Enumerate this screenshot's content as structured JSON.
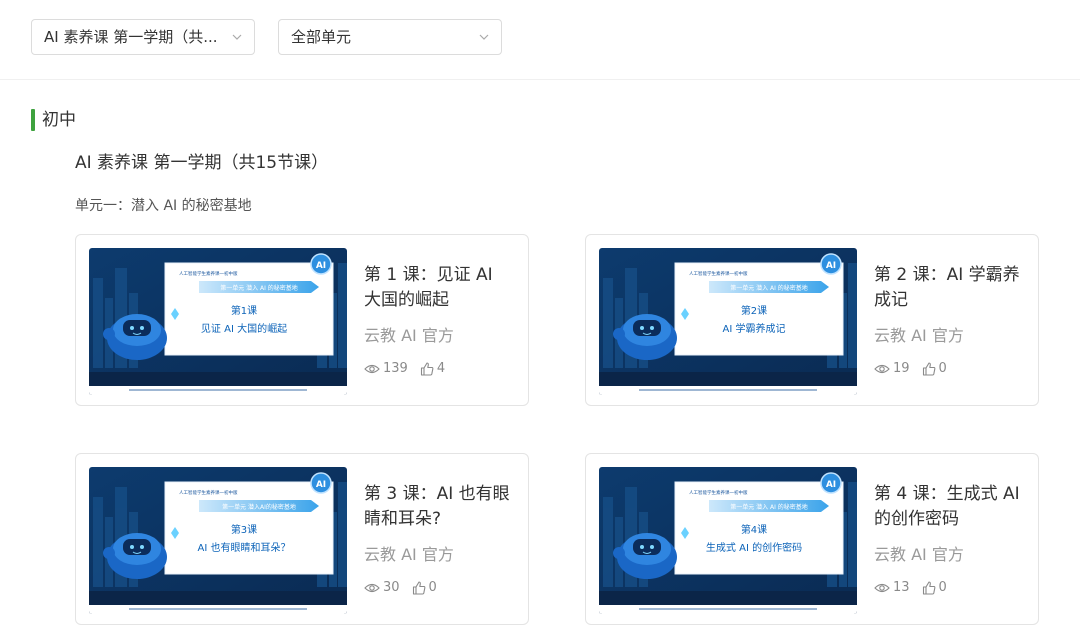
{
  "filters": {
    "course_select": "AI 素养课 第一学期（共...",
    "unit_select": "全部单元"
  },
  "section": {
    "title": "初中"
  },
  "course": {
    "title": "AI 素养课 第一学期（共15节课）"
  },
  "unit": {
    "title": "单元一：潜入 AI 的秘密基地"
  },
  "colors": {
    "accent_green": "#3ea23e",
    "thumb_navy": "#0a2f5c",
    "thumb_blue": "#1f7fd0"
  },
  "lessons": [
    {
      "title": "第 1 课：见证 AI 大国的崛起",
      "author": "云教 AI 官方",
      "views": "139",
      "likes": "4",
      "thumb": {
        "header": "人工智能学生素养课一初中版",
        "banner": "第一单元  潜入 AI 的秘密基地",
        "lesson_no": "第1课",
        "lesson_name": "见证 AI 大国的崛起",
        "badge": "AI"
      }
    },
    {
      "title": "第 2 课：AI 学霸养成记",
      "author": "云教 AI 官方",
      "views": "19",
      "likes": "0",
      "thumb": {
        "header": "人工智能学生素养课一初中版",
        "banner": "第一单元  潜入 AI 的秘密基地",
        "lesson_no": "第2课",
        "lesson_name": "AI 学霸养成记",
        "badge": "AI"
      }
    },
    {
      "title": "第 3 课：AI 也有眼睛和耳朵?",
      "author": "云教 AI 官方",
      "views": "30",
      "likes": "0",
      "thumb": {
        "header": "人工智能学生素养课一初中版",
        "banner": "第一单元  潜入AI的秘密基地",
        "lesson_no": "第3课",
        "lesson_name": "AI 也有眼睛和耳朵？",
        "badge": "AI"
      }
    },
    {
      "title": "第 4 课：生成式 AI 的创作密码",
      "author": "云教 AI 官方",
      "views": "13",
      "likes": "0",
      "thumb": {
        "header": "人工智能学生素养课一初中版",
        "banner": "第一单元  潜入 AI 的秘密基地",
        "lesson_no": "第4课",
        "lesson_name": "生成式 AI 的创作密码",
        "badge": "AI"
      }
    }
  ]
}
